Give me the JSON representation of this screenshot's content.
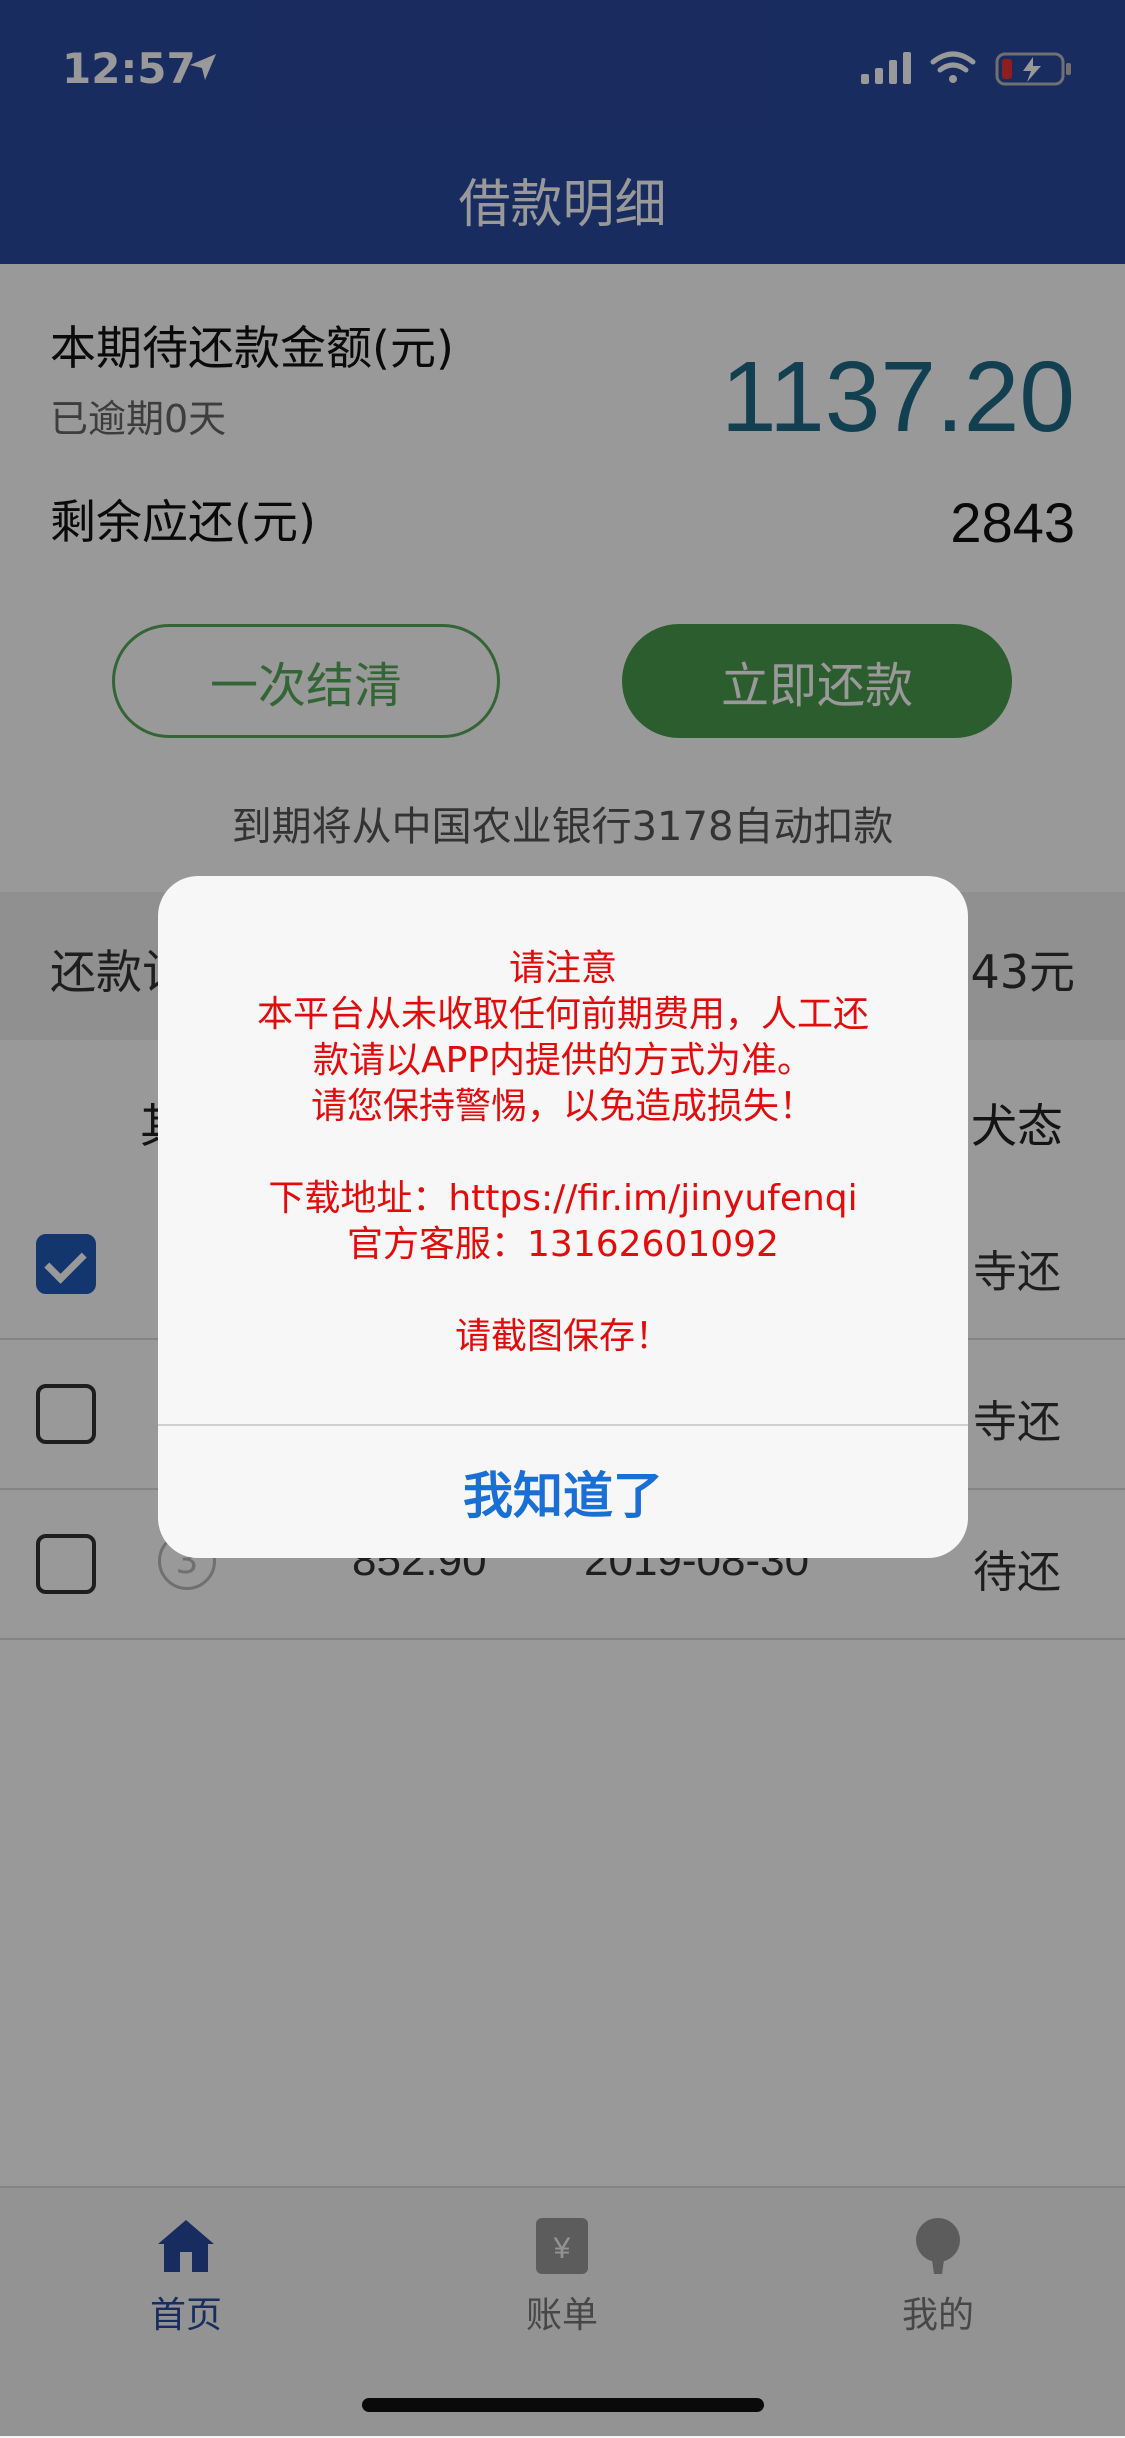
{
  "status_bar": {
    "time": "12:57"
  },
  "nav": {
    "title": "借款明细"
  },
  "summary": {
    "due_label": "本期待还款金额(元)",
    "overdue_text": "已逾期0天",
    "due_amount": "1137.20",
    "remaining_label": "剩余应还(元)",
    "remaining_amount": "2843",
    "settle_button": "一次结清",
    "pay_button": "立即还款",
    "auto_debit_note": "到期将从中国农业银行3178自动扣款"
  },
  "plan": {
    "title_visible": "还款计",
    "total_visible": "43元"
  },
  "table": {
    "headers": {
      "col1_visible": "其",
      "col5_visible": "犬态"
    },
    "rows": [
      {
        "checked": true,
        "status_visible": "寺还"
      },
      {
        "checked": false,
        "status_visible": "寺还"
      },
      {
        "checked": false,
        "index": "3",
        "amount": "852.90",
        "date": "2019-08-30",
        "status": "待还"
      }
    ]
  },
  "tabbar": {
    "items": [
      {
        "label": "首页",
        "icon": "home-icon",
        "active": true
      },
      {
        "label": "账单",
        "icon": "bill-icon",
        "active": false
      },
      {
        "label": "我的",
        "icon": "profile-icon",
        "active": false
      }
    ],
    "active_color": "#2b4a9e"
  },
  "dialog": {
    "lines": [
      "请注意",
      "本平台从未收取任何前期费用，人工还",
      "款请以APP内提供的方式为准。",
      "请您保持警惕，以免造成损失！",
      "",
      "下载地址：https://fir.im/jinyufenqi",
      "官方客服：13162601092",
      "",
      "请截图保存！"
    ],
    "confirm_button": "我知道了",
    "message_color": "#e20c0c",
    "button_color": "#1a6fd6"
  },
  "colors": {
    "brand": "#2b4a9e",
    "accent_green": "#4a9b4d",
    "amount_blue": "#1f6b87"
  }
}
